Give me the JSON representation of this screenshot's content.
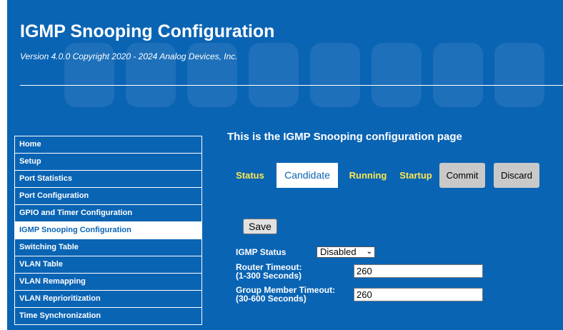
{
  "header": {
    "title": "IGMP Snooping Configuration",
    "version": "Version 4.0.0 Copyright 2020 - 2024 Analog Devices, Inc."
  },
  "sidebar": {
    "items": [
      {
        "label": "Home"
      },
      {
        "label": "Setup"
      },
      {
        "label": "Port Statistics"
      },
      {
        "label": "Port Configuration"
      },
      {
        "label": "GPIO and Timer Configuration"
      },
      {
        "label": "IGMP Snooping Configuration",
        "active": true
      },
      {
        "label": "Switching Table"
      },
      {
        "label": "VLAN Table"
      },
      {
        "label": "VLAN Remapping"
      },
      {
        "label": "VLAN Reprioritization"
      },
      {
        "label": "Time Synchronization"
      }
    ]
  },
  "main": {
    "heading": "This is the IGMP Snooping configuration page",
    "tabs": [
      {
        "label": "Status"
      },
      {
        "label": "Candidate",
        "active": true
      },
      {
        "label": "Running"
      },
      {
        "label": "Startup"
      }
    ],
    "commit_label": "Commit",
    "discard_label": "Discard",
    "save_label": "Save",
    "form": {
      "igmp_status": {
        "label": "IGMP Status",
        "value": "Disabled"
      },
      "router_timeout": {
        "label_line1": "Router Timeout:",
        "label_line2": "(1-300 Seconds)",
        "value": "260"
      },
      "group_member_timeout": {
        "label_line1": "Group Member Timeout:",
        "label_line2": "(30-600 Seconds)",
        "value": "260"
      }
    }
  },
  "colors": {
    "background": "#0a64b4",
    "tab_text": "#ffe84d",
    "button_grey": "#c9c9c9"
  },
  "icons": {
    "select_chevron": "chevron-down-icon"
  }
}
